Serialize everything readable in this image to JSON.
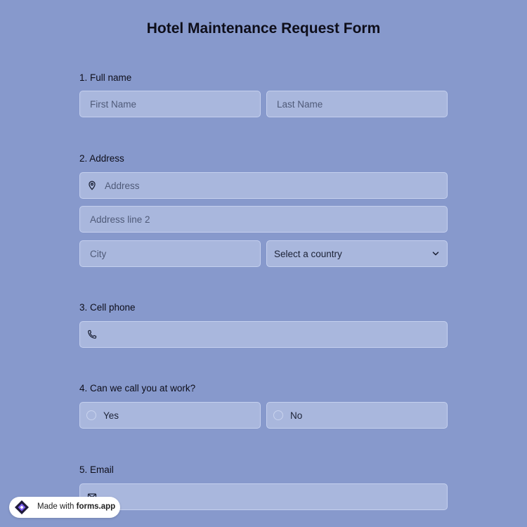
{
  "form": {
    "title": "Hotel Maintenance Request Form",
    "q1": {
      "label": "1.  Full name",
      "first_placeholder": "First Name",
      "last_placeholder": "Last Name"
    },
    "q2": {
      "label": "2. Address",
      "address_placeholder": "Address",
      "address2_placeholder": "Address line 2",
      "city_placeholder": "City",
      "country_select": "Select a country"
    },
    "q3": {
      "label": "3. Cell phone",
      "icon": "phone-icon"
    },
    "q4": {
      "label": "4. Can we call you at work?",
      "options": [
        "Yes",
        "No"
      ]
    },
    "q5": {
      "label": "5. Email",
      "icon": "mail-icon"
    }
  },
  "badge": {
    "prefix": "Made with ",
    "brand": "forms.app"
  },
  "colors": {
    "background": "#8799cc",
    "field_bg": "#a9b7dd",
    "field_border": "#c5d0ee",
    "logo_purple": "#7b5cf0",
    "logo_dark": "#1f1a3a"
  }
}
